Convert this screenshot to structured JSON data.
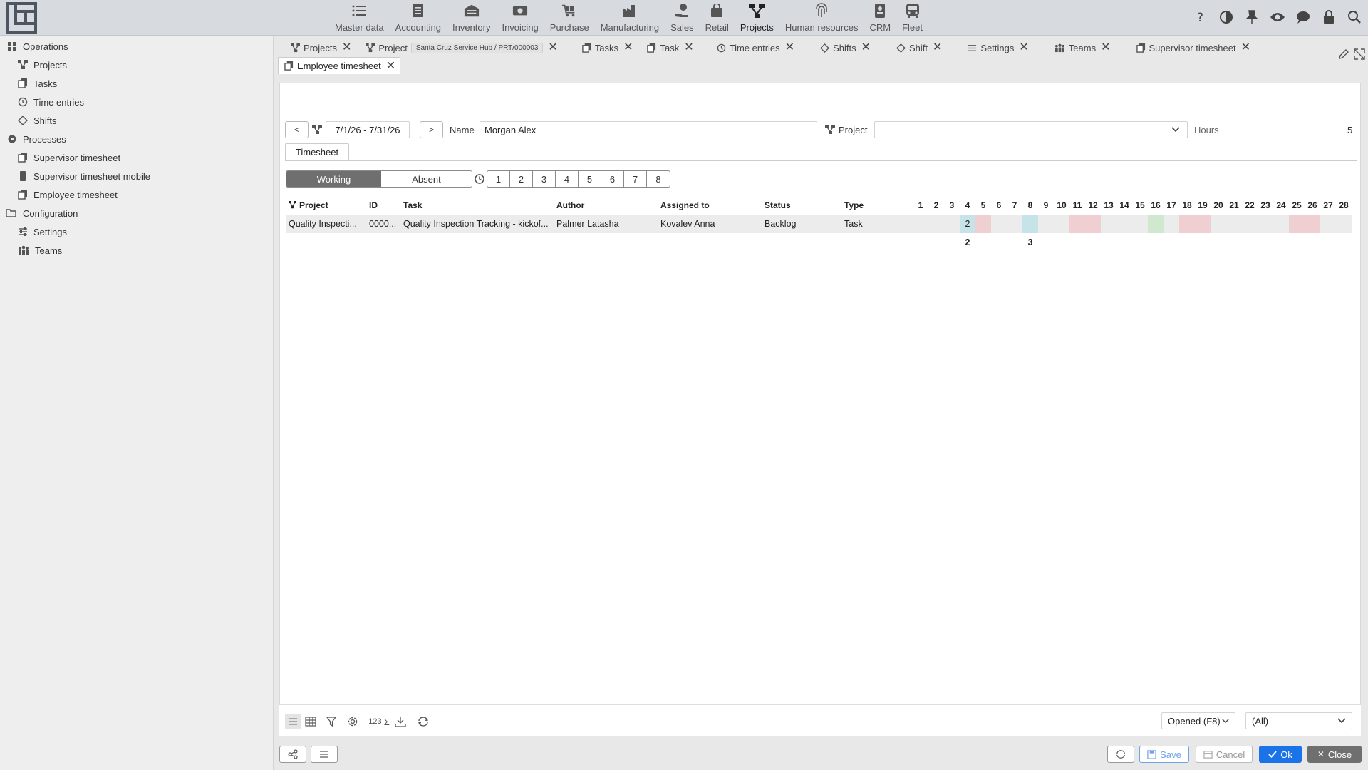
{
  "nav": {
    "items": [
      {
        "label": "Master data",
        "icon": "list-icon"
      },
      {
        "label": "Accounting",
        "icon": "document-icon"
      },
      {
        "label": "Inventory",
        "icon": "warehouse-icon"
      },
      {
        "label": "Invoicing",
        "icon": "money-icon"
      },
      {
        "label": "Purchase",
        "icon": "cart-icon"
      },
      {
        "label": "Manufacturing",
        "icon": "factory-icon"
      },
      {
        "label": "Sales",
        "icon": "hand-money-icon"
      },
      {
        "label": "Retail",
        "icon": "bag-icon"
      },
      {
        "label": "Projects",
        "icon": "project-icon"
      },
      {
        "label": "Human resources",
        "icon": "fingerprint-icon"
      },
      {
        "label": "CRM",
        "icon": "contact-icon"
      },
      {
        "label": "Fleet",
        "icon": "bus-icon"
      }
    ],
    "active": "Projects"
  },
  "sidebar": {
    "groups": [
      {
        "label": "Operations",
        "items": [
          "Projects",
          "Tasks",
          "Time entries",
          "Shifts"
        ]
      },
      {
        "label": "Processes",
        "items": [
          "Supervisor timesheet",
          "Supervisor timesheet mobile",
          "Employee timesheet"
        ]
      },
      {
        "label": "Configuration",
        "items": [
          "Settings",
          "Teams"
        ]
      }
    ]
  },
  "tabs": {
    "row1": [
      "Projects",
      "Project",
      "Tasks",
      "Task",
      "Time entries",
      "Shifts",
      "Shift",
      "Settings",
      "Teams",
      "Supervisor timesheet"
    ],
    "project_badge": "Santa Cruz Service Hub / PRT/000003",
    "row2": [
      "Employee timesheet"
    ]
  },
  "filter": {
    "prev": "<",
    "next": ">",
    "date_range": "7/1/26 - 7/31/26",
    "name_label": "Name",
    "name_value": "Morgan Alex",
    "project_label": "Project",
    "project_value": "",
    "hours_label": "Hours",
    "hours_value": "5"
  },
  "subtab": "Timesheet",
  "mode": {
    "working": "Working",
    "absent": "Absent",
    "selected": "Working"
  },
  "day_buttons": [
    "1",
    "2",
    "3",
    "4",
    "5",
    "6",
    "7",
    "8"
  ],
  "table": {
    "columns": [
      "Project",
      "ID",
      "Task",
      "Author",
      "Assigned to",
      "Status",
      "Type"
    ],
    "days": [
      "1",
      "2",
      "3",
      "4",
      "5",
      "6",
      "7",
      "8",
      "9",
      "10",
      "11",
      "12",
      "13",
      "14",
      "15",
      "16",
      "17",
      "18",
      "19",
      "20",
      "21",
      "22",
      "23",
      "24",
      "25",
      "26",
      "27",
      "28"
    ],
    "rows": [
      {
        "cells": [
          "Quality Inspecti...",
          "0000...",
          "Quality Inspection Tracking - kickof...",
          "Palmer Latasha",
          "Kovalev Anna",
          "Backlog",
          "Task"
        ],
        "day_values": {
          "4": "2"
        },
        "day_colors": {
          "4": "blue",
          "5": "red",
          "8": "blue",
          "11": "red",
          "12": "red",
          "16": "green",
          "18": "red",
          "19": "red",
          "25": "red",
          "26": "red"
        }
      }
    ],
    "totals": {
      "4": "2",
      "8": "3"
    }
  },
  "toolbar": {
    "count_label": "123",
    "sum_label": "Σ",
    "status_select": "Opened (F8)",
    "filter_select": "(All)"
  },
  "footer": {
    "save": "Save",
    "cancel": "Cancel",
    "ok": "Ok",
    "close": "Close"
  },
  "colors": {
    "accent": "#1a73e8",
    "working_bg": "#6f6f6f",
    "cell_blue": "#c6e3ea",
    "cell_red": "#f0cfd2",
    "cell_green": "#cfe8cf"
  }
}
